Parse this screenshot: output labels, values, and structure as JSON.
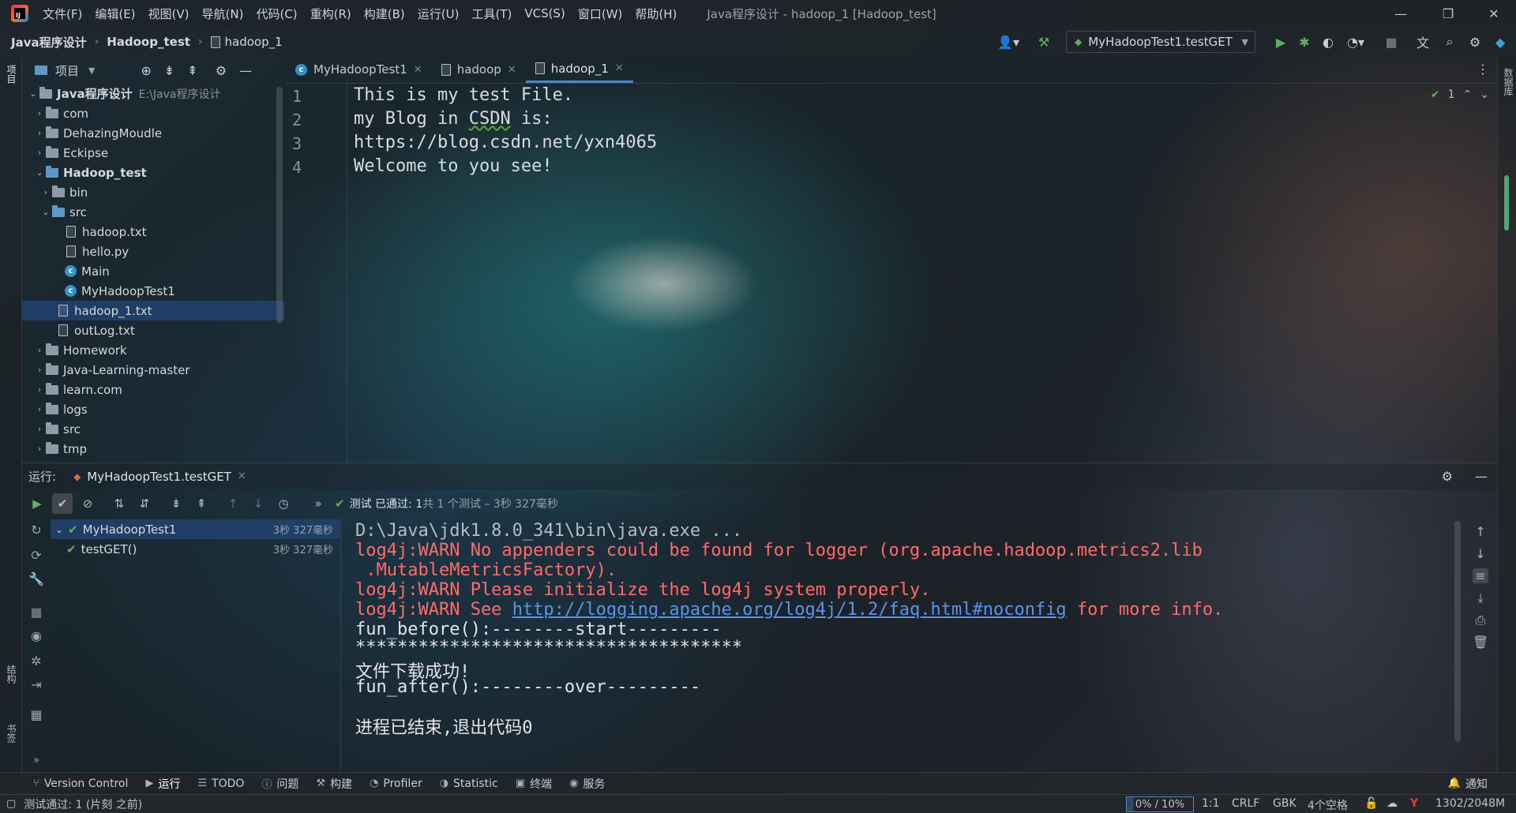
{
  "window": {
    "title": "Java程序设计 - hadoop_1 [Hadoop_test]",
    "menu": [
      "文件(F)",
      "编辑(E)",
      "视图(V)",
      "导航(N)",
      "代码(C)",
      "重构(R)",
      "构建(B)",
      "运行(U)",
      "工具(T)",
      "VCS(S)",
      "窗口(W)",
      "帮助(H)"
    ]
  },
  "breadcrumb": [
    "Java程序设计",
    "Hadoop_test",
    "hadoop_1"
  ],
  "toolbar": {
    "run_config": "MyHadoopTest1.testGET"
  },
  "left_strip": {
    "project": "项目",
    "structure": "结构",
    "bookmarks": "书签"
  },
  "right_strip": {
    "database": "数据库"
  },
  "project_panel": {
    "title": "项目",
    "root": {
      "name": "Java程序设计",
      "path": "E:\\Java程序设计"
    },
    "items": [
      {
        "label": "com"
      },
      {
        "label": "DehazingMoudle"
      },
      {
        "label": "Eckipse"
      },
      {
        "label": "Hadoop_test"
      },
      {
        "label": "bin"
      },
      {
        "label": "src"
      },
      {
        "label": "hadoop.txt"
      },
      {
        "label": "hello.py"
      },
      {
        "label": "Main"
      },
      {
        "label": "MyHadoopTest1"
      },
      {
        "label": "hadoop_1.txt"
      },
      {
        "label": "outLog.txt"
      },
      {
        "label": "Homework"
      },
      {
        "label": "Java-Learning-master"
      },
      {
        "label": "learn.com"
      },
      {
        "label": "logs"
      },
      {
        "label": "src"
      },
      {
        "label": "tmp"
      }
    ]
  },
  "editor": {
    "tabs": [
      {
        "label": "MyHadoopTest1"
      },
      {
        "label": "hadoop"
      },
      {
        "label": "hadoop_1"
      }
    ],
    "line_numbers": [
      "1",
      "2",
      "3",
      "4"
    ],
    "lines": [
      "This is my test File.",
      "my Blog in ",
      "https://blog.csdn.net/yxn4065",
      "Welcome to you see!"
    ],
    "typo_word": "CSDN",
    "line2_tail": " is:",
    "inspection_count": "1"
  },
  "run_panel": {
    "label": "运行:",
    "config_tab": "MyHadoopTest1.testGET",
    "status_prefix": "测试 已通过: 1",
    "status_suffix": "共 1 个测试 – 3秒 327毫秒",
    "tests": [
      {
        "name": "MyHadoopTest1",
        "duration": "3秒 327毫秒"
      },
      {
        "name": "testGET()",
        "duration": "3秒 327毫秒"
      }
    ],
    "console": {
      "cmd": "D:\\Java\\jdk1.8.0_341\\bin\\java.exe ...",
      "warn1": "log4j:WARN No appenders could be found for logger (org.apache.hadoop.metrics2.lib",
      "warn1b": " .MutableMetricsFactory).",
      "warn2": "log4j:WARN Please initialize the log4j system properly.",
      "warn3_pre": "log4j:WARN See ",
      "warn3_link": "http://logging.apache.org/log4j/1.2/faq.html#noconfig",
      "warn3_post": " for more info.",
      "before": "fun_before():--------start---------",
      "stars": "*************************************",
      "success": "文件下载成功!",
      "after": "fun_after():--------over---------",
      "exit": "进程已结束,退出代码0"
    }
  },
  "bottom_tools": [
    {
      "icon": "version-control-icon",
      "label": "Version Control"
    },
    {
      "icon": "run-icon",
      "label": "运行"
    },
    {
      "icon": "todo-icon",
      "label": "TODO"
    },
    {
      "icon": "problems-icon",
      "label": "问题"
    },
    {
      "icon": "build-icon",
      "label": "构建"
    },
    {
      "icon": "profiler-icon",
      "label": "Profiler"
    },
    {
      "icon": "statistic-icon",
      "label": "Statistic"
    },
    {
      "icon": "terminal-icon",
      "label": "终端"
    },
    {
      "icon": "services-icon",
      "label": "服务"
    }
  ],
  "notifications_label": "通知",
  "status_bar": {
    "message": "测试通过: 1 (片刻 之前)",
    "memory": "0% / 10%",
    "position": "1:1",
    "line_sep": "CRLF",
    "encoding": "GBK",
    "indent": "4个空格",
    "memory_usage": "1302/2048M"
  },
  "colors": {
    "accent": "#4a88c7",
    "pass": "#5fb05f",
    "warn": "#ff6b68",
    "link": "#5994ea"
  }
}
